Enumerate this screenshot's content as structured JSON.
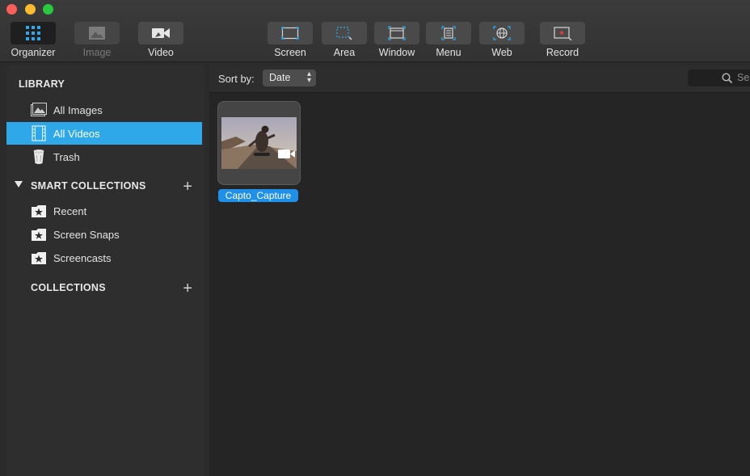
{
  "toolbar": {
    "items": [
      {
        "label": "Organizer",
        "icon": "grid-icon",
        "state": "selected"
      },
      {
        "label": "Image",
        "icon": "image-icon",
        "state": "disabled"
      },
      {
        "label": "Video",
        "icon": "video-camera-icon",
        "state": "normal"
      },
      {
        "label": "Screen",
        "icon": "screen-capture-icon",
        "state": "normal"
      },
      {
        "label": "Area",
        "icon": "area-capture-icon",
        "state": "normal"
      },
      {
        "label": "Window",
        "icon": "window-capture-icon",
        "state": "normal"
      },
      {
        "label": "Menu",
        "icon": "menu-capture-icon",
        "state": "normal"
      },
      {
        "label": "Web",
        "icon": "web-capture-icon",
        "state": "normal"
      },
      {
        "label": "Record",
        "icon": "record-icon",
        "state": "normal"
      }
    ]
  },
  "sidebar": {
    "library_title": "LIBRARY",
    "library_items": [
      {
        "label": "All Images",
        "icon": "images-icon",
        "active": false
      },
      {
        "label": "All Videos",
        "icon": "film-icon",
        "active": true
      },
      {
        "label": "Trash",
        "icon": "trash-icon",
        "active": false
      }
    ],
    "smart_collections_title": "SMART COLLECTIONS",
    "smart_items": [
      {
        "label": "Recent",
        "icon": "star-folder-icon"
      },
      {
        "label": "Screen Snaps",
        "icon": "star-folder-icon"
      },
      {
        "label": "Screencasts",
        "icon": "star-folder-icon"
      }
    ],
    "collections_title": "COLLECTIONS",
    "add_symbol": "+"
  },
  "content": {
    "sort_label": "Sort by:",
    "sort_value": "Date",
    "search_placeholder": "Sea",
    "items": [
      {
        "name": "Capto_Capture",
        "type": "video",
        "selected": true
      }
    ]
  },
  "colors": {
    "accent": "#2ea8e8",
    "selection_label": "#1f8fe8",
    "record_red": "#e83a3a"
  }
}
